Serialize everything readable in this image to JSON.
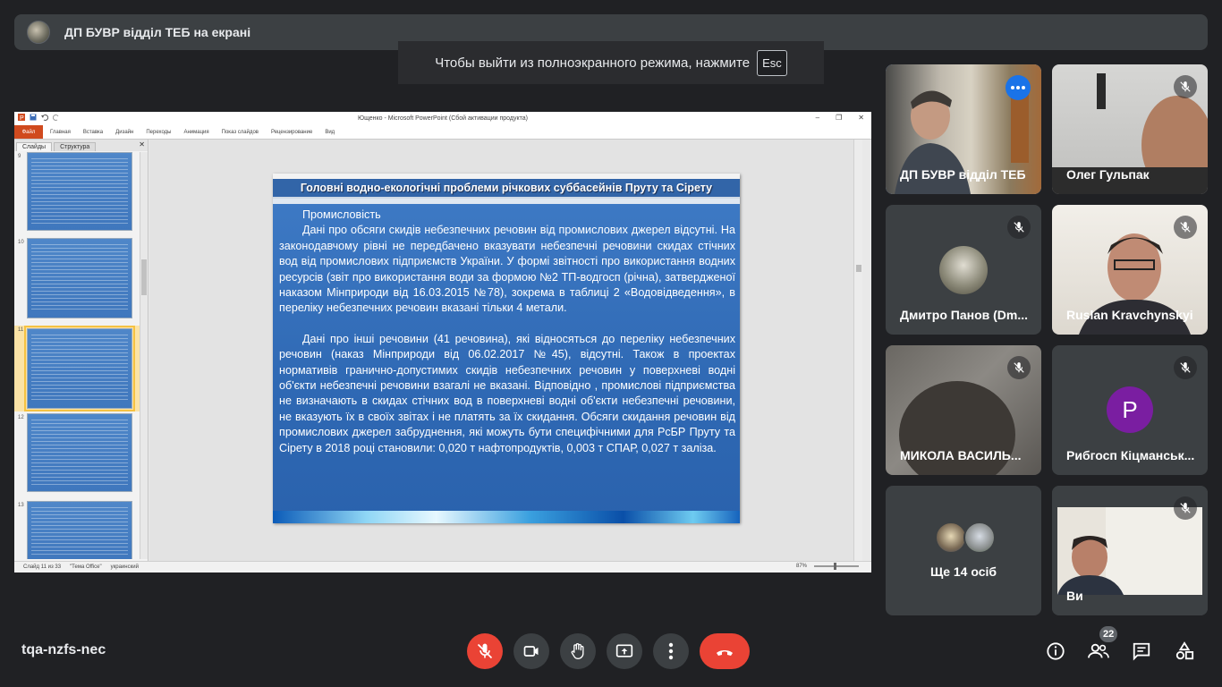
{
  "presenter": {
    "name": "ДП БУВР відділ ТЕБ на екрані"
  },
  "fullscreen_toast": {
    "text": "Чтобы выйти из полноэкранного режима, нажмите",
    "key": "Esc"
  },
  "powerpoint": {
    "window_title": "Ющенко - Microsoft PowerPoint (Сбой активации продукта)",
    "file_tab": "Файл",
    "ribbon_tabs": [
      "Главная",
      "Вставка",
      "Дизайн",
      "Переходы",
      "Анимация",
      "Показ слайдов",
      "Рецензирование",
      "Вид"
    ],
    "panel_tabs": [
      "Слайды",
      "Структура"
    ],
    "thumbnails": [
      {
        "num": "9"
      },
      {
        "num": "10"
      },
      {
        "num": "11",
        "selected": true
      },
      {
        "num": "12"
      },
      {
        "num": "13"
      }
    ],
    "slide": {
      "title": "Головні водно-екологічні проблеми річкових суббасейнів Пруту та Сірету",
      "heading": "Промисловість",
      "paragraph1": "Дані про обсяги скидів небезпечних речовин від промислових джерел відсутні. На законодавчому рівні не передбачено вказувати небезпечні речовини скидах стічних вод від промислових підприємств України. У формі звітності про використання водних ресурсів (звіт про використання води за формою №2 ТП-водгосп (річна), затвердженої наказом Мінприроди від 16.03.2015 №78), зокрема в таблиці 2 «Водовідведення», в переліку небезпечних речовин вказані тільки 4 метали.",
      "paragraph2": "Дані про інші речовини (41 речовина), які відносяться до переліку небезпечних речовин (наказ Мінприроди від 06.02.2017 №45), відсутні. Також в проектах нормативів гранично-допустимих скидів небезпечних речовин у поверхневі водні об'єкти небезпечні речовини взагалі не вказані. Відповідно , промислові підприємства не визначають в скидах стічних вод в поверхневі водні об'єкти небезпечні речовини, не вказують їх в своїх звітах і не платять за їх скидання. Обсяги скидання речовин від промислових джерел забруднення, які можуть бути специфічними для РсБР Пруту та Сірету в 2018 році становили: 0,020 т нафтопродуктів, 0,003 т СПАР, 0,027 т заліза."
    },
    "status": {
      "slide_info": "Слайд 11 из 33",
      "theme": "\"Тема Office\"",
      "language": "украинский",
      "zoom": "87%"
    }
  },
  "participants": [
    {
      "name": "ДП БУВР відділ ТЕБ",
      "muted": false,
      "active": true
    },
    {
      "name": "Олег Гульпак",
      "muted": true
    },
    {
      "name": "Дмитро Панов (Dm...",
      "muted": true
    },
    {
      "name": "Ruslan Kravchynskyi",
      "muted": true
    },
    {
      "name": "МИКОЛА ВАСИЛЬ...",
      "muted": true
    },
    {
      "name": "Рибгосп Кіцманськ...",
      "muted": true,
      "avatar_letter": "P",
      "avatar_color": "#7a1ea1"
    },
    {
      "name": "Ще 14 осіб"
    },
    {
      "name": "Ви",
      "muted": true
    }
  ],
  "meeting": {
    "code": "tqa-nzfs-nec",
    "participant_count": "22"
  },
  "colors": {
    "background": "#202124",
    "tile": "#3c4043",
    "hangup": "#ea4335",
    "active_border": "#8ab4f8",
    "more_options": "#1a73e8"
  }
}
